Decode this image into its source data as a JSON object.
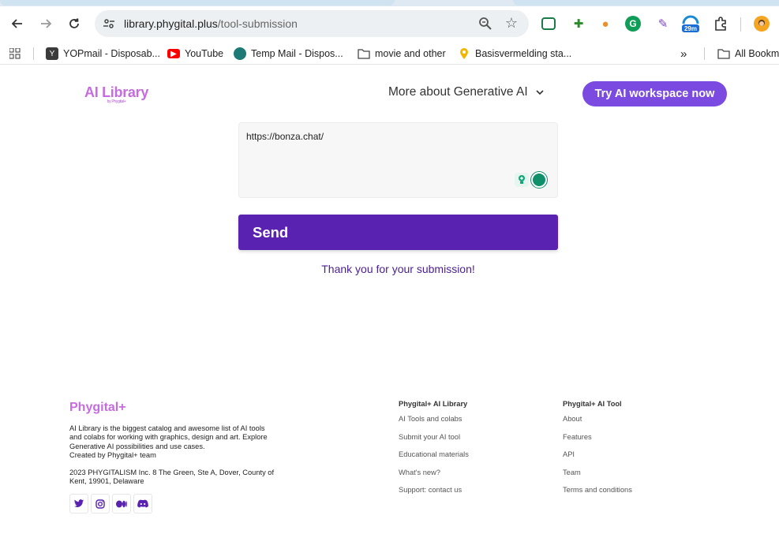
{
  "browser": {
    "url_host": "library.phygital.plus",
    "url_path": "/tool-submission",
    "extension_badge": "29m",
    "bookmarks": [
      {
        "label": "YOPmail - Disposab...",
        "icon": "yopmail-icon",
        "color": "#3b3b3b"
      },
      {
        "label": "YouTube",
        "icon": "youtube-icon",
        "color": "#ff0000"
      },
      {
        "label": "Temp Mail - Dispos...",
        "icon": "tempmail-icon",
        "color": "#1d7a74"
      },
      {
        "label": "movie and other",
        "icon": "folder-icon",
        "color": "#555555"
      },
      {
        "label": "Basisvermelding sta...",
        "icon": "location-pin-icon",
        "color": "#f4b400"
      }
    ],
    "all_bookmarks": "All Bookm"
  },
  "header": {
    "logo": "AI Library",
    "logo_sub": "by Phygital+",
    "nav_more": "More about Generative AI",
    "cta": "Try AI workspace now"
  },
  "form": {
    "input_value": "https://bonza.chat/",
    "send_label": "Send",
    "thanks": "Thank you for your submission!"
  },
  "footer": {
    "logo": "Phygital+",
    "desc": [
      "AI Library is the biggest catalog and awesome list of AI tools",
      "and colabs for working with graphics, design and art. Explore",
      "Generative AI possibilities and use cases.",
      "Created by Phygital+ team"
    ],
    "address": [
      "2023 PHYGITALISM Inc. 8 The Green, Ste A, Dover, County of",
      "Kent, 19901, Delaware"
    ],
    "col1": {
      "title": "Phygital+ AI Library",
      "links": [
        "AI Tools and colabs",
        "Submit your AI tool",
        "Educational materials",
        "What's new?",
        "Support: contact us"
      ]
    },
    "col2": {
      "title": "Phygital+ AI Tool",
      "links": [
        "About",
        "Features",
        "API",
        "Team",
        "Terms and conditions"
      ]
    }
  },
  "colors": {
    "brand_purple": "#5a22b0",
    "cta_purple": "#7b4ae0",
    "logo_pink": "#c66ce0"
  }
}
